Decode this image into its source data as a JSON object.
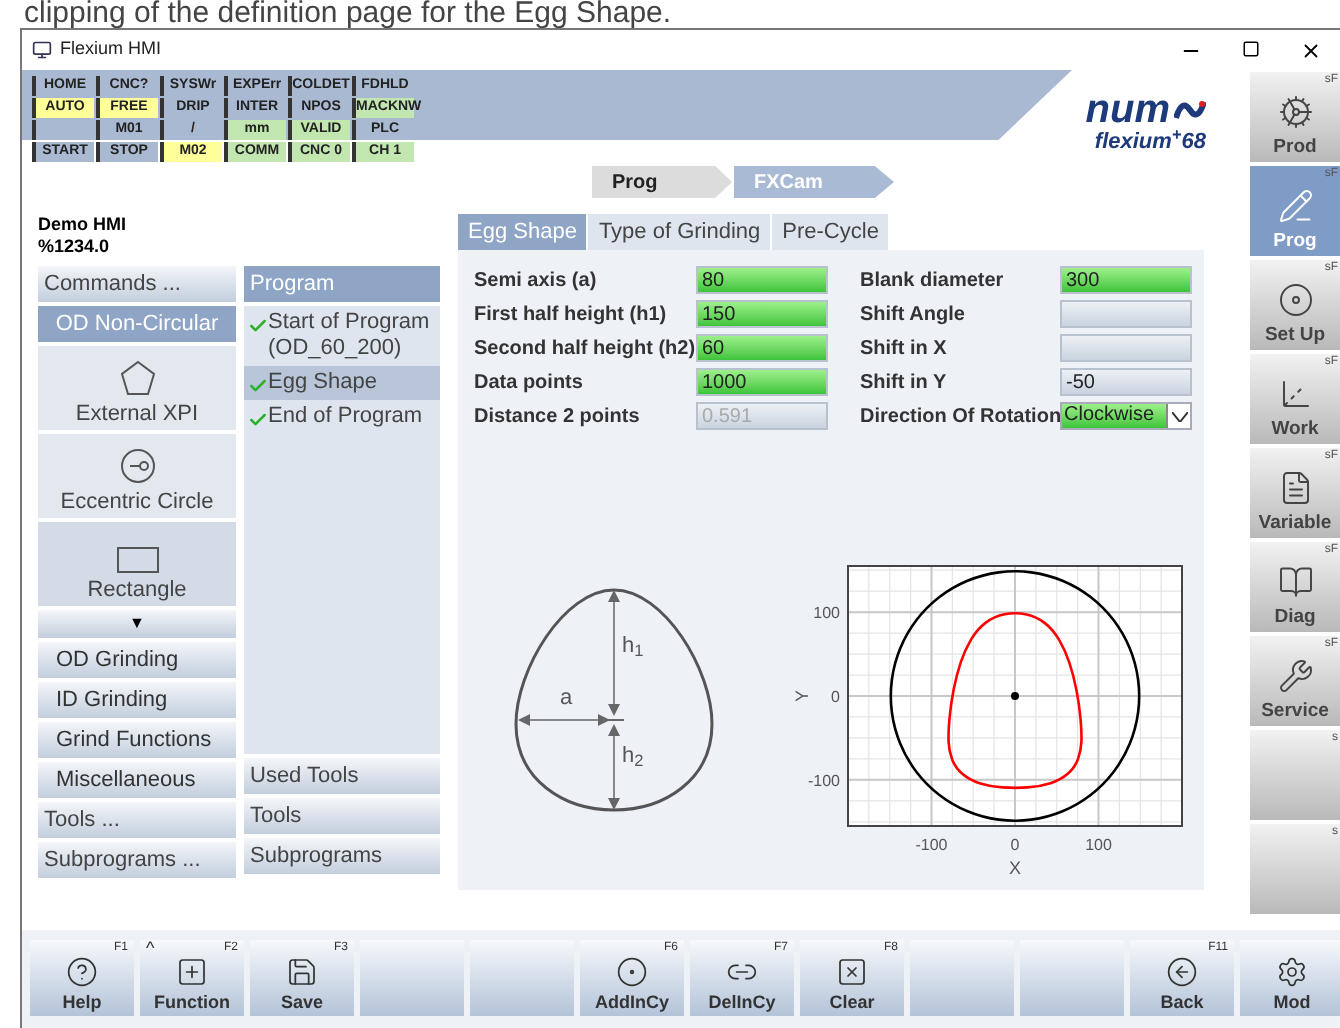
{
  "caption": "clipping of the definition page for the Egg Shape.",
  "window": {
    "title": "Flexium HMI"
  },
  "status_grid": [
    [
      {
        "text": "HOME",
        "color": "#aab9d2"
      },
      {
        "text": "CNC?",
        "color": "#aab9d2"
      },
      {
        "text": "SYSWr",
        "color": "#aab9d2"
      },
      {
        "text": "EXPErr",
        "color": "#aab9d2"
      },
      {
        "text": "COLDET",
        "color": "#aab9d2"
      },
      {
        "text": "FDHLD",
        "color": "#aab9d2"
      }
    ],
    [
      {
        "text": "AUTO",
        "color": "#ffff99"
      },
      {
        "text": "FREE",
        "color": "#ffff99"
      },
      {
        "text": "DRIP",
        "color": "#aab9d2"
      },
      {
        "text": "INTER",
        "color": "#aab9d2"
      },
      {
        "text": "NPOS",
        "color": "#aab9d2"
      },
      {
        "text": "MACKNW",
        "color": "#c2e6b0"
      }
    ],
    [
      {
        "color": "#aab9d2"
      },
      {
        "text": "M01",
        "color": "#aab9d2"
      },
      {
        "text": "/",
        "color": "#aab9d2"
      },
      {
        "text": "mm",
        "color": "#c2e6b0"
      },
      {
        "text": "VALID",
        "color": "#c2e6b0"
      },
      {
        "text": "PLC",
        "color": "#aab9d2"
      }
    ],
    [
      {
        "text": "START",
        "color": "#aab9d2"
      },
      {
        "text": "STOP",
        "color": "#aab9d2"
      },
      {
        "text": "M02",
        "color": "#ffff99"
      },
      {
        "text": "COMM",
        "color": "#c2e6b0"
      },
      {
        "text": "CNC 0",
        "color": "#c2e6b0"
      },
      {
        "text": "CH 1",
        "color": "#c2e6b0"
      }
    ]
  ],
  "logo": {
    "brand": "num",
    "product": "flexium$^{+}$68"
  },
  "breadcrumb": [
    {
      "label": "Prog",
      "selected": false
    },
    {
      "label": "FXCam",
      "selected": true
    }
  ],
  "program_info": {
    "name": "Demo HMI",
    "number": "%1234.0"
  },
  "commands": [
    {
      "kind": "header",
      "label": "Commands ..."
    },
    {
      "kind": "item",
      "label": "OD Non-Circular",
      "selected": true
    },
    {
      "kind": "icon",
      "label": "External XPI",
      "highlighted": false
    },
    {
      "kind": "icon",
      "label": "Eccentric Circle",
      "highlighted": false
    },
    {
      "kind": "icon",
      "label": "Rectangle",
      "highlighted": true
    },
    {
      "kind": "scroll",
      "label": "▼"
    },
    {
      "kind": "item",
      "label": "OD Grinding",
      "selected": false
    },
    {
      "kind": "item",
      "label": "ID Grinding",
      "selected": false
    },
    {
      "kind": "item",
      "label": "Grind Functions",
      "selected": false
    },
    {
      "kind": "item",
      "label": "Miscellaneous",
      "selected": false
    },
    {
      "kind": "header",
      "label": "Tools ..."
    },
    {
      "kind": "header",
      "label": "Subprograms ..."
    }
  ],
  "program": {
    "title": "Program",
    "steps": [
      {
        "label": "Start of Program (OD_60_200)",
        "done": true,
        "selected": false
      },
      {
        "label": "Egg Shape",
        "done": true,
        "selected": true
      },
      {
        "label": "End of Program",
        "done": true,
        "selected": false
      }
    ],
    "sections": [
      "Used Tools",
      "Tools",
      "Subprograms"
    ]
  },
  "tabs": [
    {
      "label": "Egg Shape",
      "selected": true
    },
    {
      "label": "Type of Grinding",
      "selected": false
    },
    {
      "label": "Pre-Cycle",
      "selected": false
    }
  ],
  "fields_left": [
    {
      "label": "Semi axis (a)",
      "value": "80",
      "valid": true,
      "disabled": false
    },
    {
      "label": "First half height (h1)",
      "value": "150",
      "valid": true,
      "disabled": false
    },
    {
      "label": "Second half height (h2)",
      "value": "60",
      "valid": true,
      "disabled": false
    },
    {
      "label": "Data points",
      "value": "1000",
      "valid": true,
      "disabled": false
    },
    {
      "label": "Distance 2 points",
      "value": "0.591",
      "valid": false,
      "disabled": true
    }
  ],
  "fields_right": [
    {
      "kind": "input",
      "label": "Blank diameter",
      "value": "300",
      "valid": true
    },
    {
      "kind": "input",
      "label": "Shift Angle",
      "valid": false
    },
    {
      "kind": "input",
      "label": "Shift in X",
      "valid": false
    },
    {
      "kind": "input",
      "label": "Shift in Y",
      "value": "-50",
      "valid": false
    },
    {
      "kind": "dropdown",
      "label": "Direction Of Rotation",
      "value": "Clockwise",
      "valid": true
    }
  ],
  "egg_diagram": {
    "labels": [
      "a",
      "h$_{1}$",
      "h$_{2}$"
    ]
  },
  "plot": {
    "xlabel": "X",
    "ylabel": "Y",
    "x_ticks": [
      "-100",
      "0",
      "100"
    ],
    "y_ticks": [
      "100",
      "0",
      "-100"
    ]
  },
  "side_menu": [
    {
      "label": "Prod",
      "shortcut": "sF",
      "selected": false
    },
    {
      "label": "Prog",
      "shortcut": "sF",
      "selected": true
    },
    {
      "label": "Set Up",
      "shortcut": "sF",
      "selected": false
    },
    {
      "label": "Work",
      "shortcut": "sF",
      "selected": false
    },
    {
      "label": "Variable",
      "shortcut": "sF",
      "selected": false
    },
    {
      "label": "Diag",
      "shortcut": "sF",
      "selected": false
    },
    {
      "label": "Service",
      "shortcut": "sF",
      "selected": false
    },
    {
      "shortcut": "s",
      "selected": false
    },
    {
      "shortcut": "s",
      "selected": false
    }
  ],
  "function_keys": [
    {
      "kind": "key",
      "label": "Help",
      "key": "F1"
    },
    {
      "kind": "key",
      "label": "Function",
      "key": "F2",
      "mark": "^"
    },
    {
      "kind": "key",
      "label": "Save",
      "key": "F3"
    },
    {
      "kind": "blank"
    },
    {
      "kind": "blank"
    },
    {
      "kind": "key",
      "label": "AddInCy",
      "key": "F6"
    },
    {
      "kind": "key",
      "label": "DelInCy",
      "key": "F7"
    },
    {
      "kind": "key",
      "label": "Clear",
      "key": "F8"
    },
    {
      "kind": "blank"
    },
    {
      "kind": "blank"
    },
    {
      "kind": "key",
      "label": "Back",
      "key": "F11"
    },
    {
      "kind": "key",
      "label": "Mod"
    }
  ]
}
